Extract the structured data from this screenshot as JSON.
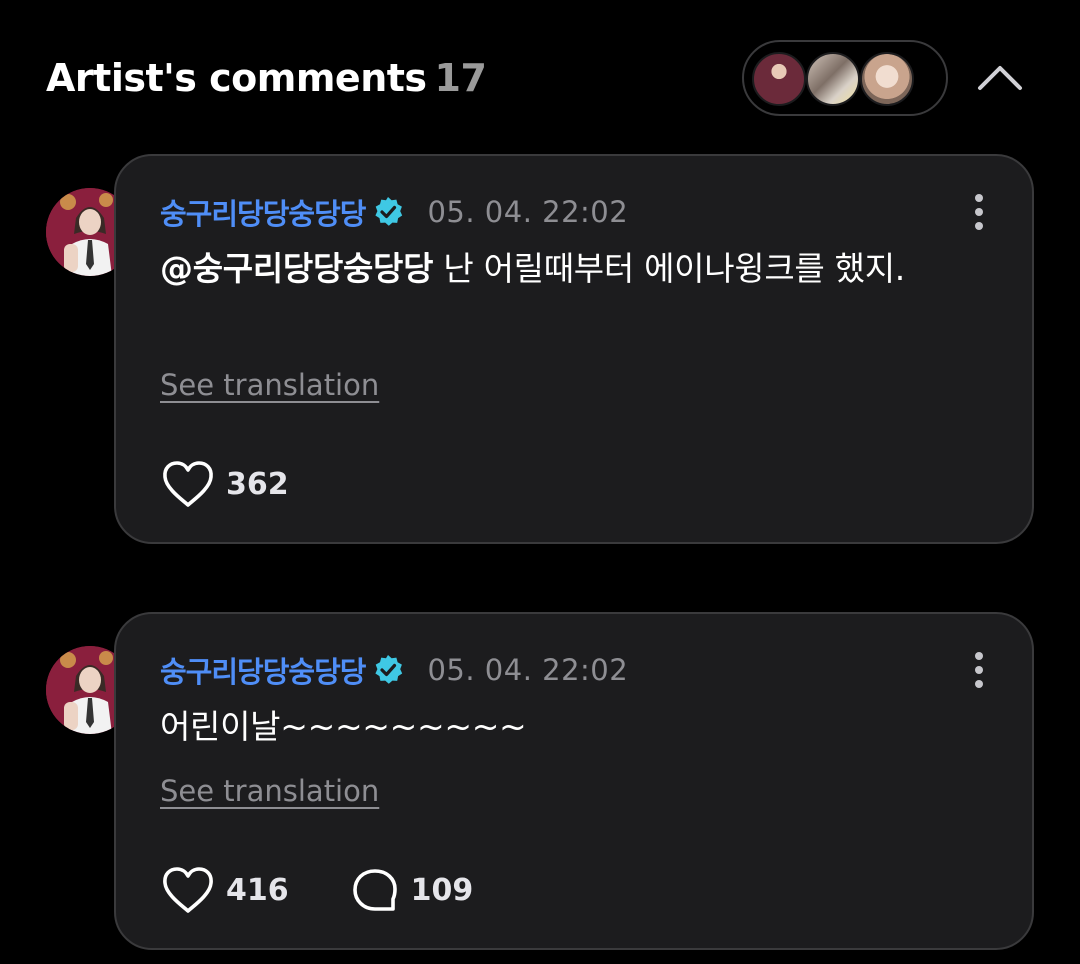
{
  "header": {
    "title": "Artist's comments",
    "count": "17",
    "participant_avatars": [
      "artist-avatar",
      "fan-avatar-1",
      "fan-avatar-2"
    ]
  },
  "colors": {
    "background": "#000000",
    "card_background": "#1c1c1e",
    "card_border": "#3a3a3c",
    "author_blue": "#4f8ef7",
    "verified_cyan": "#3fc8e4",
    "muted_text": "#8e8e93"
  },
  "comments": [
    {
      "author": "숭구리당당숭당당",
      "timestamp": "05. 04. 22:02",
      "mention": "@숭구리당당숭당당",
      "text": " 난 어릴때부터 에이나윙크를 했지.",
      "see_translation": "See translation",
      "likes": "362",
      "replies": ""
    },
    {
      "author": "숭구리당당숭당당",
      "timestamp": "05. 04. 22:02",
      "mention": "",
      "text": "어린이날~~~~~~~~~",
      "see_translation": "See translation",
      "likes": "416",
      "replies": "109"
    }
  ],
  "icons": {
    "collapse": "chevron-up-icon",
    "verified": "verified-badge-icon",
    "more": "more-vertical-icon",
    "like": "heart-icon",
    "reply": "comment-bubble-icon"
  }
}
